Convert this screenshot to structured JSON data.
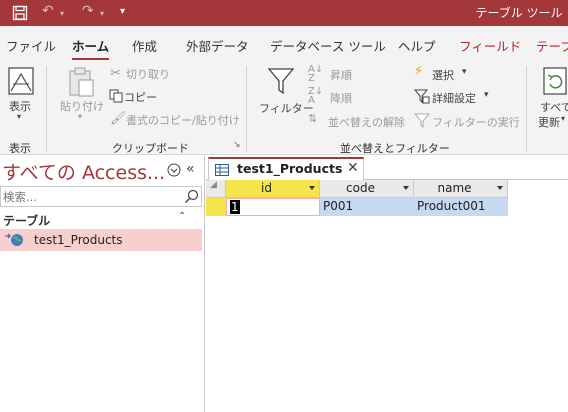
{
  "titlebar": {
    "context_label": "テーブル ツール"
  },
  "tabs": [
    "ファイル",
    "ホーム",
    "作成",
    "外部データ",
    "データベース ツール",
    "ヘルプ",
    "フィールド",
    "テーブ"
  ],
  "ribbon": {
    "view": {
      "label": "表示"
    },
    "view_group": "表示",
    "paste": {
      "label": "貼り付け"
    },
    "cut": {
      "label": "切り取り"
    },
    "copy": {
      "label": "コピー"
    },
    "format_painter": {
      "label": "書式のコピー/貼り付け"
    },
    "clipboard_group": "クリップボード",
    "filter": {
      "label": "フィルター"
    },
    "asc": {
      "label": "昇順"
    },
    "desc": {
      "label": "降順"
    },
    "remove_sort": {
      "label": "並べ替えの解除"
    },
    "selection": {
      "label": "選択"
    },
    "advanced": {
      "label": "詳細設定"
    },
    "toggle_filter": {
      "label": "フィルターの実行"
    },
    "sort_group": "並べ替えとフィルター",
    "refresh": {
      "label1": "すべて",
      "label2": "更新"
    }
  },
  "nav": {
    "title": "すべての Access...",
    "search_placeholder": "検索...",
    "category": "テーブル",
    "items": [
      {
        "label": "test1_Products"
      }
    ]
  },
  "document": {
    "tab_label": "test1_Products",
    "columns": [
      "id",
      "code",
      "name"
    ],
    "rows": [
      {
        "id": "1",
        "code": "P001",
        "name": "Product001"
      }
    ]
  },
  "colors": {
    "accent": "#a4373a",
    "selected_header": "#f5e44a",
    "row_selected": "#c6d9f0"
  }
}
